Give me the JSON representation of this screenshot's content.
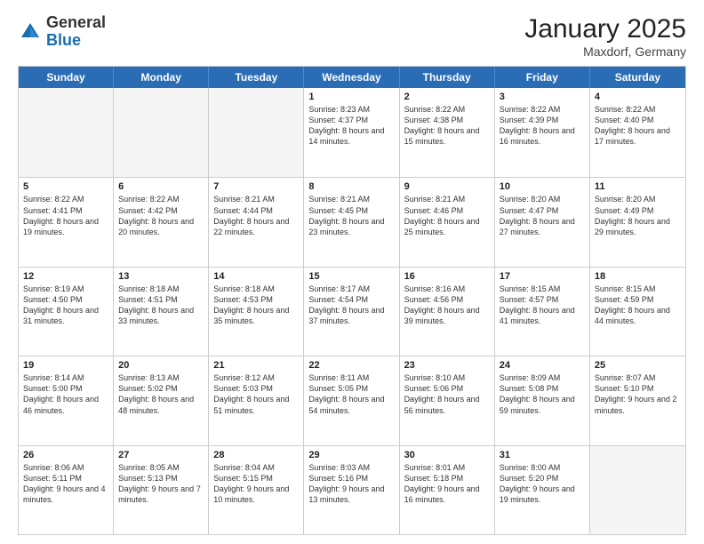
{
  "header": {
    "logo": {
      "general": "General",
      "blue": "Blue"
    },
    "title": "January 2025",
    "location": "Maxdorf, Germany"
  },
  "days": [
    "Sunday",
    "Monday",
    "Tuesday",
    "Wednesday",
    "Thursday",
    "Friday",
    "Saturday"
  ],
  "weeks": [
    [
      {
        "day": "",
        "empty": true,
        "text": ""
      },
      {
        "day": "",
        "empty": true,
        "text": ""
      },
      {
        "day": "",
        "empty": true,
        "text": ""
      },
      {
        "day": "1",
        "text": "Sunrise: 8:23 AM\nSunset: 4:37 PM\nDaylight: 8 hours\nand 14 minutes."
      },
      {
        "day": "2",
        "text": "Sunrise: 8:22 AM\nSunset: 4:38 PM\nDaylight: 8 hours\nand 15 minutes."
      },
      {
        "day": "3",
        "text": "Sunrise: 8:22 AM\nSunset: 4:39 PM\nDaylight: 8 hours\nand 16 minutes."
      },
      {
        "day": "4",
        "text": "Sunrise: 8:22 AM\nSunset: 4:40 PM\nDaylight: 8 hours\nand 17 minutes."
      }
    ],
    [
      {
        "day": "5",
        "text": "Sunrise: 8:22 AM\nSunset: 4:41 PM\nDaylight: 8 hours\nand 19 minutes."
      },
      {
        "day": "6",
        "text": "Sunrise: 8:22 AM\nSunset: 4:42 PM\nDaylight: 8 hours\nand 20 minutes."
      },
      {
        "day": "7",
        "text": "Sunrise: 8:21 AM\nSunset: 4:44 PM\nDaylight: 8 hours\nand 22 minutes."
      },
      {
        "day": "8",
        "text": "Sunrise: 8:21 AM\nSunset: 4:45 PM\nDaylight: 8 hours\nand 23 minutes."
      },
      {
        "day": "9",
        "text": "Sunrise: 8:21 AM\nSunset: 4:46 PM\nDaylight: 8 hours\nand 25 minutes."
      },
      {
        "day": "10",
        "text": "Sunrise: 8:20 AM\nSunset: 4:47 PM\nDaylight: 8 hours\nand 27 minutes."
      },
      {
        "day": "11",
        "text": "Sunrise: 8:20 AM\nSunset: 4:49 PM\nDaylight: 8 hours\nand 29 minutes."
      }
    ],
    [
      {
        "day": "12",
        "text": "Sunrise: 8:19 AM\nSunset: 4:50 PM\nDaylight: 8 hours\nand 31 minutes."
      },
      {
        "day": "13",
        "text": "Sunrise: 8:18 AM\nSunset: 4:51 PM\nDaylight: 8 hours\nand 33 minutes."
      },
      {
        "day": "14",
        "text": "Sunrise: 8:18 AM\nSunset: 4:53 PM\nDaylight: 8 hours\nand 35 minutes."
      },
      {
        "day": "15",
        "text": "Sunrise: 8:17 AM\nSunset: 4:54 PM\nDaylight: 8 hours\nand 37 minutes."
      },
      {
        "day": "16",
        "text": "Sunrise: 8:16 AM\nSunset: 4:56 PM\nDaylight: 8 hours\nand 39 minutes."
      },
      {
        "day": "17",
        "text": "Sunrise: 8:15 AM\nSunset: 4:57 PM\nDaylight: 8 hours\nand 41 minutes."
      },
      {
        "day": "18",
        "text": "Sunrise: 8:15 AM\nSunset: 4:59 PM\nDaylight: 8 hours\nand 44 minutes."
      }
    ],
    [
      {
        "day": "19",
        "text": "Sunrise: 8:14 AM\nSunset: 5:00 PM\nDaylight: 8 hours\nand 46 minutes."
      },
      {
        "day": "20",
        "text": "Sunrise: 8:13 AM\nSunset: 5:02 PM\nDaylight: 8 hours\nand 48 minutes."
      },
      {
        "day": "21",
        "text": "Sunrise: 8:12 AM\nSunset: 5:03 PM\nDaylight: 8 hours\nand 51 minutes."
      },
      {
        "day": "22",
        "text": "Sunrise: 8:11 AM\nSunset: 5:05 PM\nDaylight: 8 hours\nand 54 minutes."
      },
      {
        "day": "23",
        "text": "Sunrise: 8:10 AM\nSunset: 5:06 PM\nDaylight: 8 hours\nand 56 minutes."
      },
      {
        "day": "24",
        "text": "Sunrise: 8:09 AM\nSunset: 5:08 PM\nDaylight: 8 hours\nand 59 minutes."
      },
      {
        "day": "25",
        "text": "Sunrise: 8:07 AM\nSunset: 5:10 PM\nDaylight: 9 hours\nand 2 minutes."
      }
    ],
    [
      {
        "day": "26",
        "text": "Sunrise: 8:06 AM\nSunset: 5:11 PM\nDaylight: 9 hours\nand 4 minutes."
      },
      {
        "day": "27",
        "text": "Sunrise: 8:05 AM\nSunset: 5:13 PM\nDaylight: 9 hours\nand 7 minutes."
      },
      {
        "day": "28",
        "text": "Sunrise: 8:04 AM\nSunset: 5:15 PM\nDaylight: 9 hours\nand 10 minutes."
      },
      {
        "day": "29",
        "text": "Sunrise: 8:03 AM\nSunset: 5:16 PM\nDaylight: 9 hours\nand 13 minutes."
      },
      {
        "day": "30",
        "text": "Sunrise: 8:01 AM\nSunset: 5:18 PM\nDaylight: 9 hours\nand 16 minutes."
      },
      {
        "day": "31",
        "text": "Sunrise: 8:00 AM\nSunset: 5:20 PM\nDaylight: 9 hours\nand 19 minutes."
      },
      {
        "day": "",
        "empty": true,
        "text": ""
      }
    ]
  ]
}
